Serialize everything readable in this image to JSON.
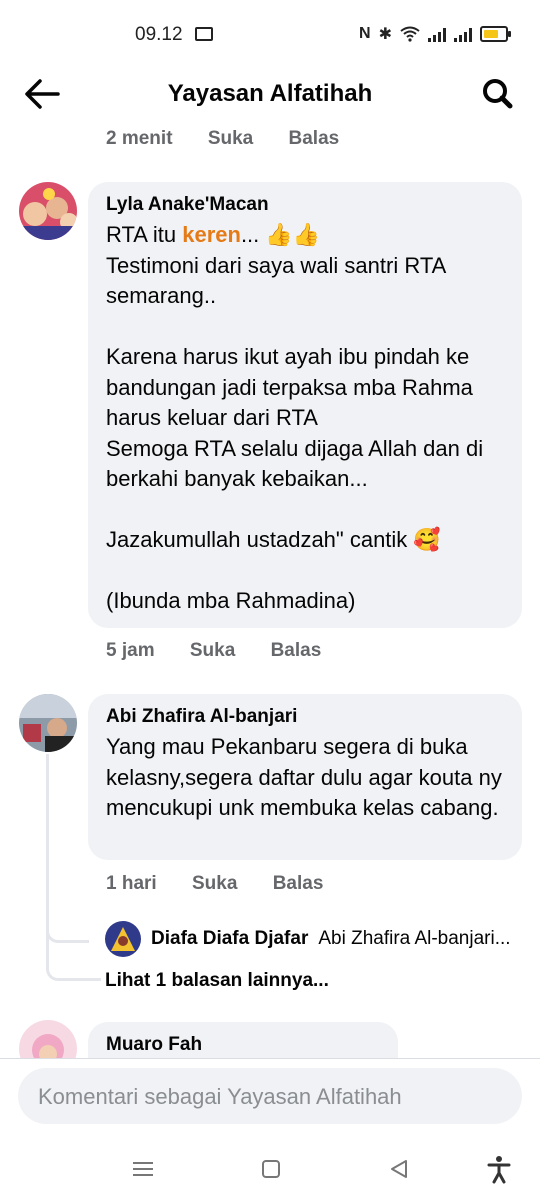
{
  "status_bar": {
    "time": "09.12",
    "icons": [
      "screen-cast-icon",
      "nfc-icon",
      "bluetooth-icon",
      "wifi-icon",
      "signal-icon",
      "signal-icon",
      "battery-icon"
    ]
  },
  "header": {
    "title": "Yayasan Alfatihah",
    "back_icon": "arrow-left-icon",
    "search_icon": "search-icon"
  },
  "top_meta": {
    "time": "2 menit",
    "like": "Suka",
    "reply": "Balas"
  },
  "comments": [
    {
      "author": "Lyla Anake'Macan",
      "text_pre": "RTA itu ",
      "text_highlight": "keren",
      "text_post": "... 👍👍\nTestimoni dari saya wali santri RTA semarang..\n\nKarena harus ikut ayah ibu pindah ke bandungan jadi terpaksa mba Rahma harus keluar dari RTA\nSemoga RTA selalu dijaga Allah dan di berkahi banyak kebaikan...\n\nJazakumullah ustadzah\" cantik 🥰\n\n(Ibunda mba Rahmadina)",
      "time": "5 jam",
      "like": "Suka",
      "reply": "Balas"
    },
    {
      "author": "Abi Zhafira Al-banjari",
      "text": "Yang mau Pekanbaru segera di buka kelasny,segera daftar dulu agar kouta ny mencukupi unk membuka kelas cabang.",
      "time": "1 hari",
      "like": "Suka",
      "reply": "Balas",
      "reply_preview": {
        "author": "Diafa Diafa Djafar",
        "text": "Abi Zhafira Al-banjari..."
      },
      "more_replies": "Lihat 1 balasan lainnya..."
    },
    {
      "author": "Muaro Fah"
    }
  ],
  "composer": {
    "placeholder": "Komentari sebagai Yayasan Alfatihah"
  },
  "navbar": {
    "icons": [
      "menu-icon",
      "home-square-icon",
      "back-triangle-icon",
      "accessibility-icon"
    ]
  }
}
